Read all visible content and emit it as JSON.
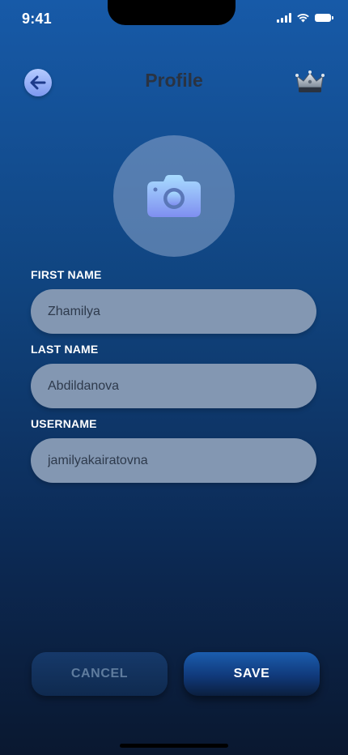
{
  "status_bar": {
    "time": "9:41"
  },
  "header": {
    "title": "Profile",
    "back_icon": "arrow-left-icon",
    "right_icon": "crown-icon"
  },
  "avatar": {
    "icon": "camera-icon"
  },
  "form": {
    "first_name": {
      "label": "FIRST NAME",
      "value": "Zhamilya"
    },
    "last_name": {
      "label": "LAST NAME",
      "value": "Abdildanova"
    },
    "username": {
      "label": "USERNAME",
      "value": "jamilyakairatovna"
    }
  },
  "actions": {
    "cancel_label": "CANCEL",
    "save_label": "SAVE"
  },
  "colors": {
    "background_top": "#175aa8",
    "background_bottom": "#0a1830",
    "input_fill": "#8397b2",
    "accent": "#1b5dae"
  }
}
